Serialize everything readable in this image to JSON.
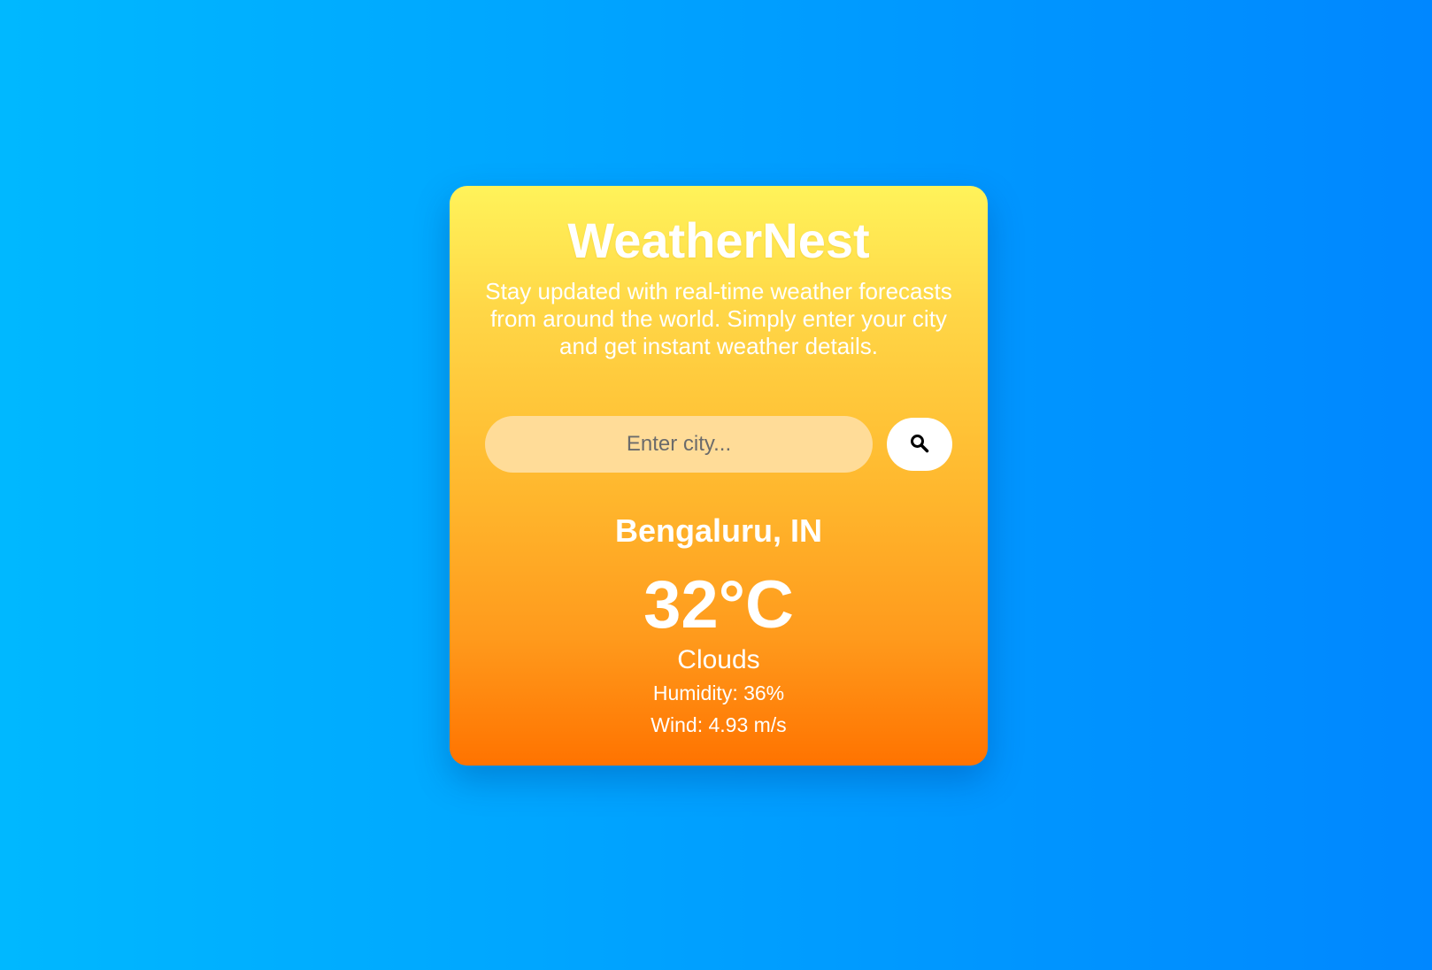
{
  "app": {
    "title": "WeatherNest",
    "subtitle": "Stay updated with real-time weather forecasts from around the world. Simply enter your city and get instant weather details."
  },
  "search": {
    "placeholder": "Enter city...",
    "value": "",
    "button_icon": "search-icon"
  },
  "weather": {
    "location": "Bengaluru, IN",
    "temperature": "32°C",
    "condition": "Clouds",
    "humidity": "Humidity: 36%",
    "wind": "Wind: 4.93 m/s"
  },
  "colors": {
    "background_left": "#00b8ff",
    "background_right": "#0087ff",
    "card_top": "#fff35a",
    "card_bottom": "#ff7300",
    "input_background": "#ffdc98",
    "text": "#ffffff"
  }
}
